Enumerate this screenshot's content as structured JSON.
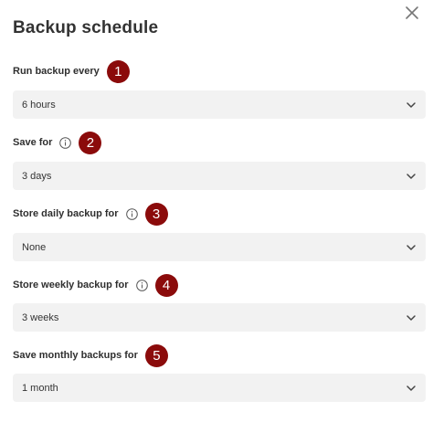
{
  "dialog": {
    "title": "Backup schedule",
    "close_icon": "close-icon"
  },
  "fields": [
    {
      "label": "Run backup every",
      "value": "6 hours",
      "info": false,
      "marker": "1"
    },
    {
      "label": "Save for",
      "value": "3 days",
      "info": true,
      "marker": "2"
    },
    {
      "label": "Store daily backup for",
      "value": "None",
      "info": true,
      "marker": "3"
    },
    {
      "label": "Store weekly backup for",
      "value": "3 weeks",
      "info": true,
      "marker": "4"
    },
    {
      "label": "Save monthly backups for",
      "value": "1 month",
      "info": false,
      "marker": "5"
    }
  ],
  "colors": {
    "marker": "#8b0b0b",
    "select_bg": "#f2f2f2"
  }
}
